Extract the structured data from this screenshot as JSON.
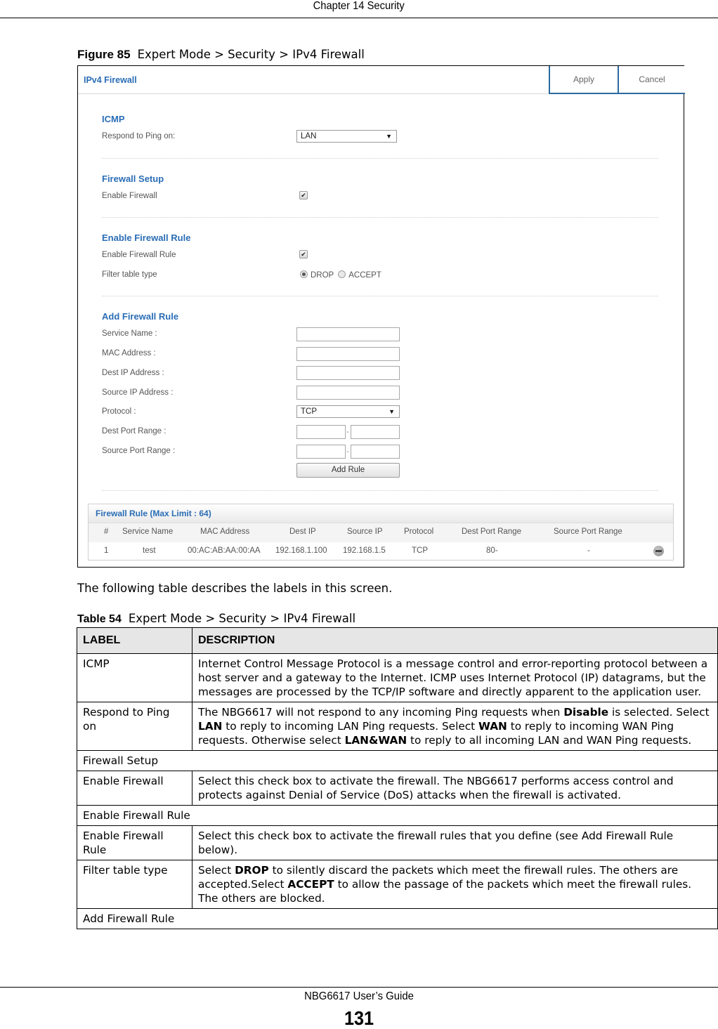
{
  "page": {
    "header": "Chapter 14 Security",
    "footer_guide": "NBG6617 User’s Guide",
    "page_number": "131"
  },
  "figure": {
    "label": "Figure 85",
    "caption": "Expert Mode > Security > IPv4 Firewall"
  },
  "screen": {
    "title": "IPv4 Firewall",
    "apply_label": "Apply",
    "cancel_label": "Cancel",
    "accent_color": "#2a6db5",
    "icmp": {
      "title": "ICMP",
      "respond_label": "Respond to Ping on:",
      "respond_value": "LAN"
    },
    "firewall_setup": {
      "title": "Firewall Setup",
      "enable_label": "Enable Firewall",
      "enable_checked": true
    },
    "enable_rule": {
      "title": "Enable Firewall Rule",
      "enable_label": "Enable Firewall Rule",
      "enable_checked": true,
      "filter_label": "Filter table type",
      "options": [
        "DROP",
        "ACCEPT"
      ],
      "selected": "DROP"
    },
    "add_rule": {
      "title": "Add Firewall Rule",
      "service_name_label": "Service Name :",
      "service_name_value": "",
      "mac_label": "MAC Address :",
      "mac_value": "",
      "dest_ip_label": "Dest IP Address :",
      "dest_ip_value": "",
      "source_ip_label": "Source IP Address :",
      "source_ip_value": "",
      "protocol_label": "Protocol :",
      "protocol_value": "TCP",
      "dest_port_label": "Dest Port Range :",
      "source_port_label": "Source Port Range :",
      "range_separator": "-",
      "add_button": "Add Rule"
    },
    "rule_table": {
      "title": "Firewall Rule (Max Limit : 64)",
      "columns": [
        "#",
        "Service Name",
        "MAC Address",
        "Dest IP",
        "Source IP",
        "Protocol",
        "Dest Port Range",
        "Source Port Range"
      ],
      "rows": [
        {
          "num": "1",
          "service": "test",
          "mac": "00:AC:AB:AA:00:AA",
          "dest_ip": "192.168.1.100",
          "source_ip": "192.168.1.5",
          "protocol": "TCP",
          "dest_port": "80-",
          "source_port": "-",
          "action_icon": "delete-icon"
        }
      ]
    }
  },
  "intro_text": "The following table describes the labels in this screen.",
  "table": {
    "label": "Table 54",
    "caption": "Expert Mode > Security > IPv4 Firewall",
    "header_label": "LABEL",
    "header_desc": "DESCRIPTION",
    "rows": [
      {
        "label": "ICMP",
        "desc": "Internet Control Message Protocol is a message control and error-reporting protocol between a host server and a gateway to the Internet. ICMP uses Internet Protocol (IP) datagrams, but the messages are processed by the TCP/IP software and directly apparent to the application user."
      },
      {
        "label": "Respond to Ping on",
        "desc_parts": [
          {
            "t": "The NBG6617 will not respond to any incoming Ping requests when "
          },
          {
            "b": "Disable"
          },
          {
            "t": " is selected. Select "
          },
          {
            "b": "LAN"
          },
          {
            "t": " to reply to incoming LAN Ping requests. Select "
          },
          {
            "b": "WAN"
          },
          {
            "t": " to reply to incoming WAN Ping requests. Otherwise select "
          },
          {
            "b": "LAN&WAN"
          },
          {
            "t": " to reply to all incoming LAN and WAN Ping requests."
          }
        ]
      },
      {
        "section": "Firewall Setup"
      },
      {
        "label": "Enable Firewall",
        "desc": "Select this check box to activate the firewall. The NBG6617 performs access control and protects against Denial of Service (DoS) attacks when the firewall is activated."
      },
      {
        "section": "Enable Firewall Rule"
      },
      {
        "label": "Enable Firewall Rule",
        "desc": "Select this check box to activate the firewall rules that you define (see Add Firewall Rule below)."
      },
      {
        "label": "Filter table type",
        "desc_parts": [
          {
            "t": "Select "
          },
          {
            "b": "DROP"
          },
          {
            "t": " to silently discard the packets which meet the firewall rules. The others are accepted.Select "
          },
          {
            "b": "ACCEPT"
          },
          {
            "t": " to allow the passage of the packets which meet the firewall rules. The others are blocked."
          }
        ]
      },
      {
        "section": "Add Firewall Rule"
      }
    ]
  }
}
